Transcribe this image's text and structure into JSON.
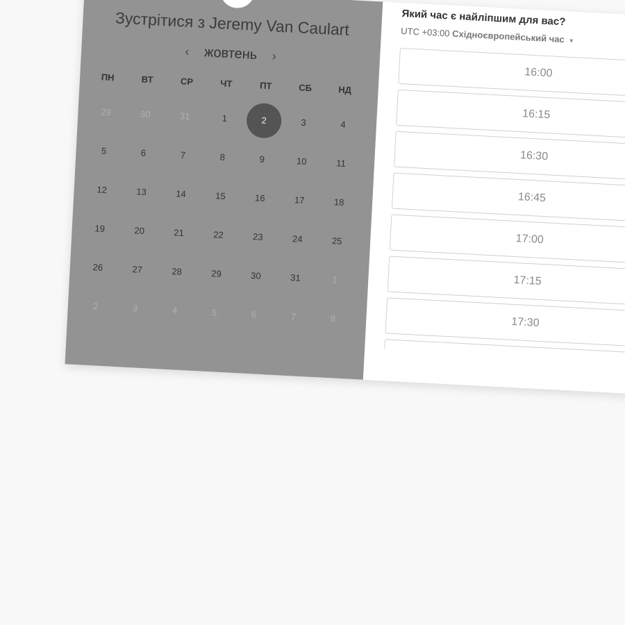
{
  "meeting": {
    "title_prefix": "Зустрітися з",
    "host": "Jeremy Van Caulart"
  },
  "calendar": {
    "month": "жовтень",
    "prev_label": "‹",
    "next_label": "›",
    "weekdays": [
      "ПН",
      "ВТ",
      "СР",
      "ЧТ",
      "ПТ",
      "СБ",
      "НД"
    ],
    "weeks": [
      [
        {
          "d": "29",
          "muted": true
        },
        {
          "d": "30",
          "muted": true
        },
        {
          "d": "31",
          "muted": true
        },
        {
          "d": "1"
        },
        {
          "d": "2",
          "selected": true
        },
        {
          "d": "3"
        },
        {
          "d": "4"
        }
      ],
      [
        {
          "d": "5"
        },
        {
          "d": "6"
        },
        {
          "d": "7"
        },
        {
          "d": "8"
        },
        {
          "d": "9"
        },
        {
          "d": "10"
        },
        {
          "d": "11"
        }
      ],
      [
        {
          "d": "12"
        },
        {
          "d": "13"
        },
        {
          "d": "14"
        },
        {
          "d": "15"
        },
        {
          "d": "16"
        },
        {
          "d": "17"
        },
        {
          "d": "18"
        }
      ],
      [
        {
          "d": "19"
        },
        {
          "d": "20"
        },
        {
          "d": "21"
        },
        {
          "d": "22"
        },
        {
          "d": "23"
        },
        {
          "d": "24"
        },
        {
          "d": "25"
        }
      ],
      [
        {
          "d": "26"
        },
        {
          "d": "27"
        },
        {
          "d": "28"
        },
        {
          "d": "29"
        },
        {
          "d": "30"
        },
        {
          "d": "31"
        },
        {
          "d": "1",
          "muted": true
        }
      ],
      [
        {
          "d": "2",
          "muted": true
        },
        {
          "d": "3",
          "muted": true
        },
        {
          "d": "4",
          "muted": true
        },
        {
          "d": "5",
          "muted": true
        },
        {
          "d": "6",
          "muted": true
        },
        {
          "d": "7",
          "muted": true
        },
        {
          "d": "8",
          "muted": true
        }
      ]
    ]
  },
  "times": {
    "question": "Який час є найліпшим для вас?",
    "timezone_offset": "UTC +03:00",
    "timezone_name": "Східноєвропейський час",
    "slots": [
      "16:00",
      "16:15",
      "16:30",
      "16:45",
      "17:00",
      "17:15",
      "17:30",
      ""
    ]
  }
}
